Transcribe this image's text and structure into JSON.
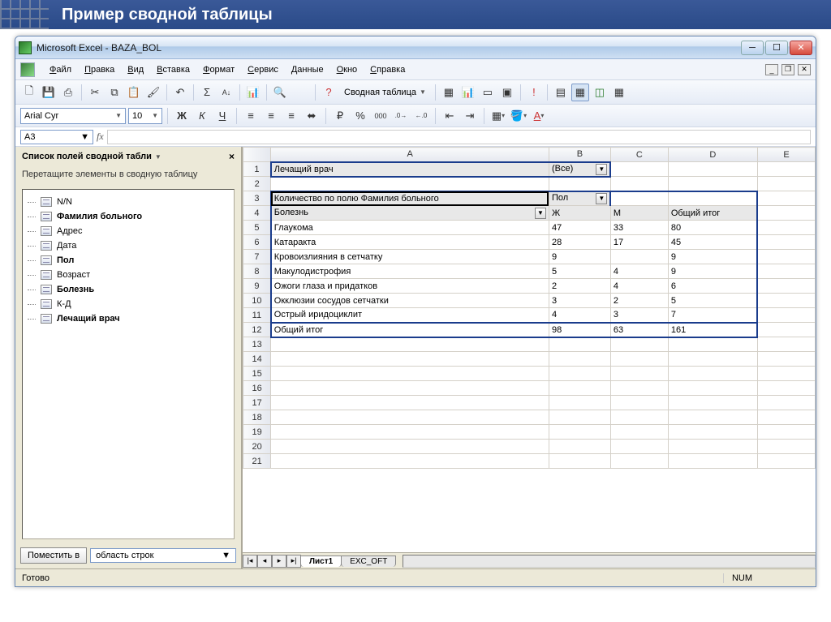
{
  "slide_title": "Пример сводной таблицы",
  "window_title": "Microsoft Excel - BAZA_BOL",
  "menus": [
    "Файл",
    "Правка",
    "Вид",
    "Вставка",
    "Формат",
    "Сервис",
    "Данные",
    "Окно",
    "Справка"
  ],
  "pivot_toolbar_label": "Сводная таблица",
  "font_name": "Arial Cyr",
  "font_size": "10",
  "namebox": "A3",
  "fieldlist": {
    "title": "Список полей сводной табли",
    "hint": "Перетащите элементы в сводную таблицу",
    "items": [
      {
        "label": "N/N",
        "bold": false
      },
      {
        "label": "Фамилия больного",
        "bold": true
      },
      {
        "label": "Адрес",
        "bold": false
      },
      {
        "label": "Дата",
        "bold": false
      },
      {
        "label": "Пол",
        "bold": true
      },
      {
        "label": "Возраст",
        "bold": false
      },
      {
        "label": "Болезнь",
        "bold": true
      },
      {
        "label": "К-Д",
        "bold": false
      },
      {
        "label": "Лечащий врач",
        "bold": true
      }
    ],
    "place_btn": "Поместить в",
    "area_combo": "область строк"
  },
  "columns": [
    "A",
    "B",
    "C",
    "D",
    "E"
  ],
  "pivot": {
    "page_field": "Лечащий врач",
    "page_value": "(Все)",
    "data_field": "Количество по полю Фамилия больного",
    "col_field": "Пол",
    "row_field": "Болезнь",
    "col_headers": [
      "Ж",
      "М",
      "Общий итог"
    ],
    "rows": [
      {
        "n": 5,
        "label": "Глаукома",
        "v": [
          47,
          33,
          80
        ]
      },
      {
        "n": 6,
        "label": "Катаракта",
        "v": [
          28,
          17,
          45
        ]
      },
      {
        "n": 7,
        "label": "Кровоизлияния в сетчатку",
        "v": [
          9,
          "",
          9
        ]
      },
      {
        "n": 8,
        "label": "Макулодистрофия",
        "v": [
          5,
          4,
          9
        ]
      },
      {
        "n": 9,
        "label": "Ожоги глаза и придатков",
        "v": [
          2,
          4,
          6
        ]
      },
      {
        "n": 10,
        "label": "Окклюзии сосудов сетчатки",
        "v": [
          3,
          2,
          5
        ]
      },
      {
        "n": 11,
        "label": "Острый иридоциклит",
        "v": [
          4,
          3,
          7
        ]
      }
    ],
    "total_label": "Общий итог",
    "totals": [
      98,
      63,
      161
    ]
  },
  "empty_rows": [
    13,
    14,
    15,
    16,
    17,
    18,
    19,
    20,
    21
  ],
  "sheets": {
    "active": "Лист1",
    "other": "EXC_OFT"
  },
  "status": {
    "ready": "Готово",
    "num": "NUM"
  }
}
